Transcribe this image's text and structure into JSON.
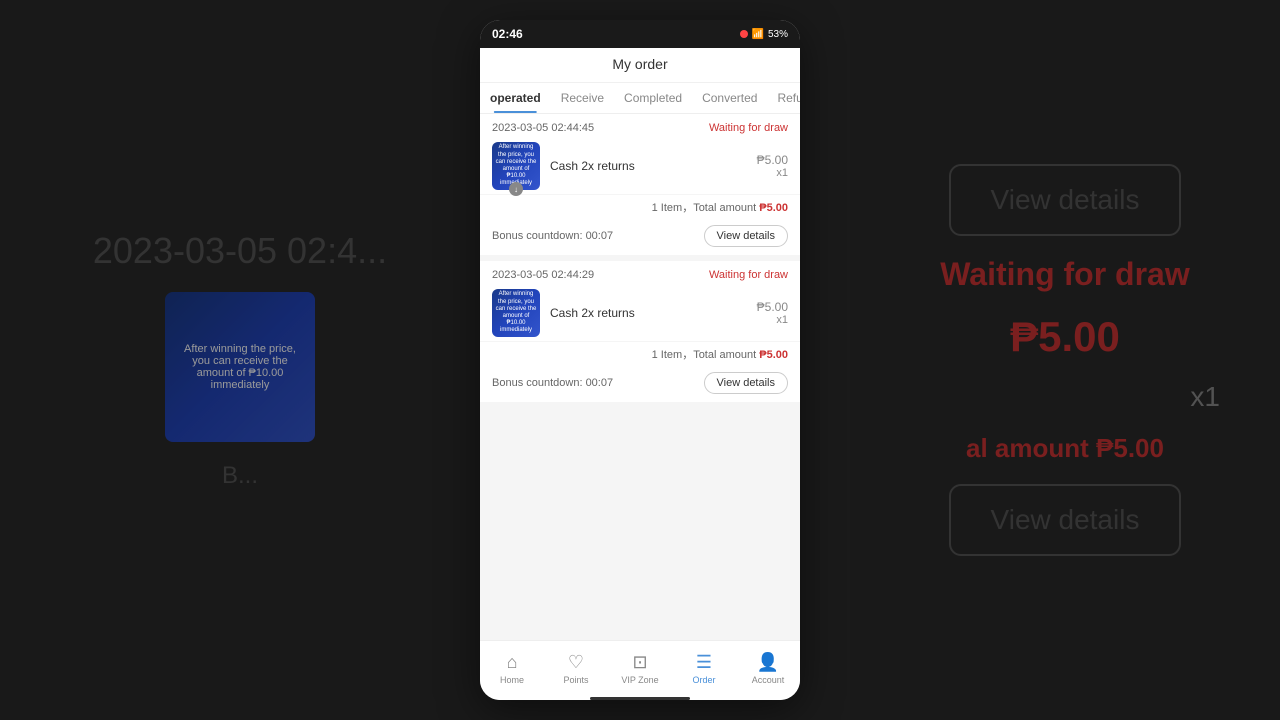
{
  "statusBar": {
    "time": "02:46",
    "battery": "53%"
  },
  "pageTitle": "My order",
  "tabs": [
    {
      "label": "operated",
      "active": true
    },
    {
      "label": "Receive",
      "active": false
    },
    {
      "label": "Completed",
      "active": false
    },
    {
      "label": "Converted",
      "active": false
    },
    {
      "label": "Refund",
      "active": false
    }
  ],
  "orders": [
    {
      "date": "2023-03-05 02:44:45",
      "status": "Waiting for draw",
      "itemName": "Cash 2x returns",
      "price": "₱5.00",
      "qty": "x1",
      "totalLabel": "1 Item，Total amount",
      "totalAmount": "₱5.00",
      "bonusCountdown": "Bonus countdown: 00:07",
      "viewDetailsLabel": "View details",
      "thumbnailText": "After winning the price, you can receive the amount of ₱10.00 immediately"
    },
    {
      "date": "2023-03-05 02:44:29",
      "status": "Waiting for draw",
      "itemName": "Cash 2x returns",
      "price": "₱5.00",
      "qty": "x1",
      "totalLabel": "1 Item，Total amount",
      "totalAmount": "₱5.00",
      "bonusCountdown": "Bonus countdown: 00:07",
      "viewDetailsLabel": "View details",
      "thumbnailText": "After winning the price, you can receive the amount of ₱10.00 immediately"
    }
  ],
  "bottomNav": [
    {
      "label": "Home",
      "icon": "⌂",
      "active": false
    },
    {
      "label": "Points",
      "icon": "♡",
      "active": false
    },
    {
      "label": "VIP Zone",
      "icon": "⊡",
      "active": false
    },
    {
      "label": "Order",
      "icon": "☰",
      "active": true
    },
    {
      "label": "Account",
      "icon": "👤",
      "active": false
    }
  ],
  "background": {
    "leftDate": "2023-03-05 02:4...",
    "leftThumbText": "After winning the price, you can receive the amount of ₱10.00 immediately",
    "rightViewDetails": "View details",
    "rightWaiting": "Waiting for draw",
    "rightPrice": "₱5.00",
    "rightX1": "x1",
    "rightTotalLabel": "al amount",
    "rightTotalAmount": "₱5.00",
    "rightViewDetails2": "View details"
  }
}
